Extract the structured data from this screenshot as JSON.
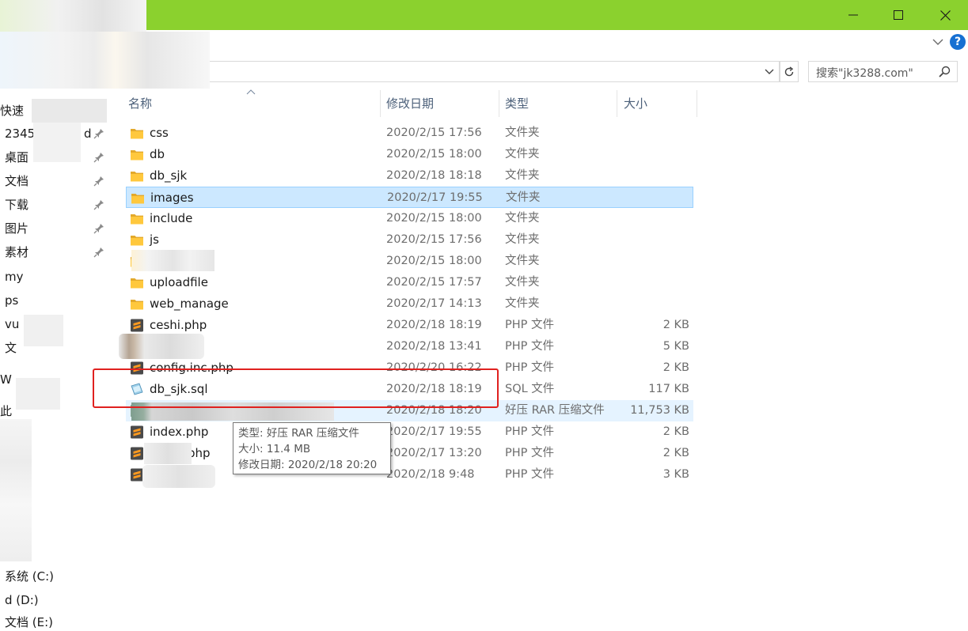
{
  "window": {
    "controls": {
      "minimize_icon": "minimize-icon",
      "maximize_icon": "maximize-icon",
      "close_icon": "close-icon"
    },
    "accent_color": "#8bd12e"
  },
  "search": {
    "placeholder": "搜索\"jk3288.com\""
  },
  "nav": {
    "quick_access": "快速",
    "items": [
      {
        "label": "2345",
        "suffix": "d",
        "pinned": true
      },
      {
        "label": "桌面",
        "pinned": true
      },
      {
        "label": "文档",
        "pinned": true
      },
      {
        "label": "下载",
        "pinned": true
      },
      {
        "label": "图片",
        "pinned": true
      },
      {
        "label": "素材",
        "pinned": true
      },
      {
        "label": "my"
      },
      {
        "label": "ps"
      },
      {
        "label": "vu"
      },
      {
        "label": "文"
      },
      {
        "label": "W"
      },
      {
        "label": "此"
      }
    ],
    "drives": [
      {
        "label": "系统 (C:)"
      },
      {
        "label": "d (D:)"
      },
      {
        "label": "文档 (E:)"
      }
    ]
  },
  "columns": {
    "name": "名称",
    "date": "修改日期",
    "type": "类型",
    "size": "大小"
  },
  "files": [
    {
      "name": "css",
      "date": "2020/2/15 17:56",
      "type": "文件夹",
      "size": "",
      "icon": "folder-icon"
    },
    {
      "name": "db",
      "date": "2020/2/15 18:00",
      "type": "文件夹",
      "size": "",
      "icon": "folder-icon"
    },
    {
      "name": "db_sjk",
      "date": "2020/2/18 18:18",
      "type": "文件夹",
      "size": "",
      "icon": "folder-icon"
    },
    {
      "name": "images",
      "date": "2020/2/17 19:55",
      "type": "文件夹",
      "size": "",
      "icon": "folder-icon",
      "state": "selected"
    },
    {
      "name": "include",
      "date": "2020/2/15 18:00",
      "type": "文件夹",
      "size": "",
      "icon": "folder-icon"
    },
    {
      "name": "js",
      "date": "2020/2/15 17:56",
      "type": "文件夹",
      "size": "",
      "icon": "folder-icon"
    },
    {
      "name": "",
      "date": "2020/2/15 18:00",
      "type": "文件夹",
      "size": "",
      "icon": "folder-icon",
      "obscured": true
    },
    {
      "name": "uploadfile",
      "date": "2020/2/15 17:57",
      "type": "文件夹",
      "size": "",
      "icon": "folder-icon"
    },
    {
      "name": "web_manage",
      "date": "2020/2/17 14:13",
      "type": "文件夹",
      "size": "",
      "icon": "folder-icon"
    },
    {
      "name": "ceshi.php",
      "date": "2020/2/18 18:19",
      "type": "PHP 文件",
      "size": "2 KB",
      "icon": "sublime-file-icon"
    },
    {
      "name": "",
      "date": "2020/2/18 13:41",
      "type": "PHP 文件",
      "size": "5 KB",
      "icon": "sublime-file-icon",
      "obscured": true
    },
    {
      "name": "config.inc.php",
      "date": "2020/2/20 16:22",
      "type": "PHP 文件",
      "size": "2 KB",
      "icon": "sublime-file-icon"
    },
    {
      "name": "db_sjk.sql",
      "date": "2020/2/18 18:19",
      "type": "SQL 文件",
      "size": "117 KB",
      "icon": "sql-file-icon"
    },
    {
      "name": "",
      "date": "2020/2/18 18:20",
      "type": "好压 RAR 压缩文件",
      "size": "11,753 KB",
      "icon": "archive-icon",
      "state": "hover",
      "obscured": true
    },
    {
      "name": "index.php",
      "date": "2020/2/17 19:55",
      "type": "PHP 文件",
      "size": "2 KB",
      "icon": "sublime-file-icon"
    },
    {
      "name": "php",
      "date": "2020/2/17 13:20",
      "type": "PHP 文件",
      "size": "2 KB",
      "icon": "sublime-file-icon",
      "partially_obscured": true
    },
    {
      "name": "",
      "date": "2020/2/18 9:48",
      "type": "PHP 文件",
      "size": "3 KB",
      "icon": "sublime-file-icon",
      "obscured": true
    }
  ],
  "tooltip": {
    "type_line": "类型: 好压 RAR 压缩文件",
    "size_line": "大小: 11.4 MB",
    "date_line": "修改日期: 2020/2/18 20:20"
  },
  "highlight_color": "#e0211f"
}
